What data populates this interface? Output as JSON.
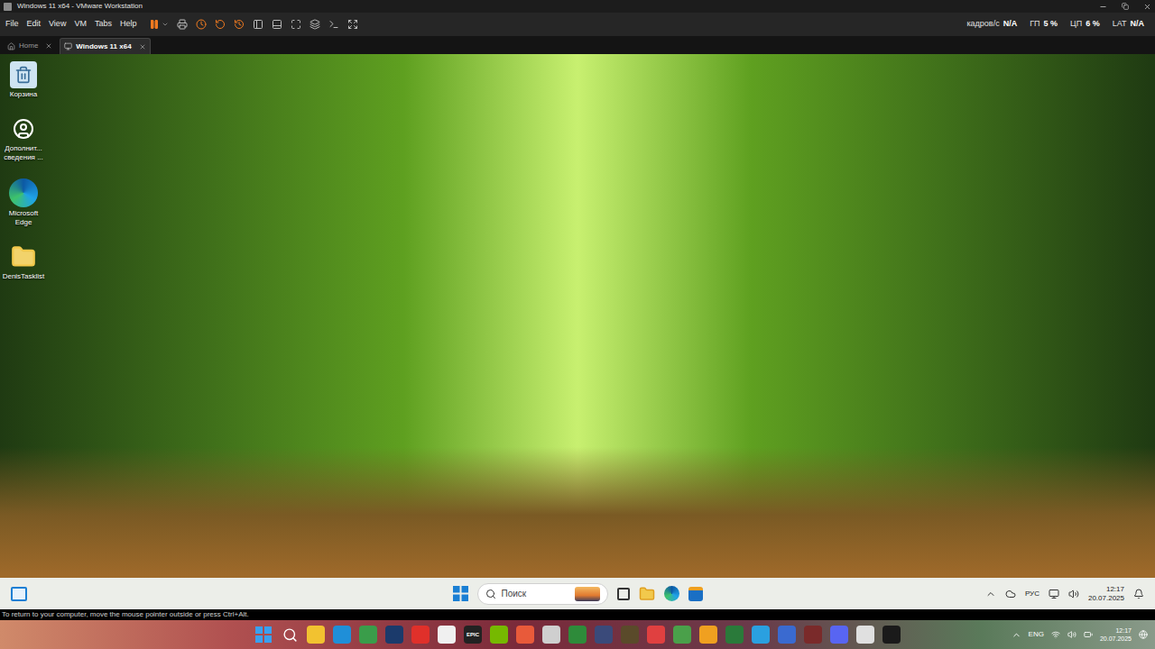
{
  "window": {
    "title": "Windows 11 x64 - VMware Workstation"
  },
  "menu": [
    "File",
    "Edit",
    "View",
    "VM",
    "Tabs",
    "Help"
  ],
  "stats": [
    {
      "label": "кадров/с",
      "value": "N/A"
    },
    {
      "label": "ГП",
      "value": "5 %"
    },
    {
      "label": "ЦП",
      "value": "6 %"
    },
    {
      "label": "LAT",
      "value": "N/A"
    }
  ],
  "tabs": [
    {
      "label": "Home",
      "kind": "home",
      "selected": false
    },
    {
      "label": "Windows 11 x64",
      "kind": "vm",
      "selected": true
    }
  ],
  "guest": {
    "desktop_icons": [
      {
        "label": "Корзина",
        "kind": "recycle"
      },
      {
        "label": "Дополнит... сведения ...",
        "kind": "info"
      },
      {
        "label": "Microsoft Edge",
        "kind": "edge"
      },
      {
        "label": "DenisTasklist",
        "kind": "folder"
      }
    ],
    "taskbar": {
      "search": {
        "placeholder": "Поиск"
      },
      "language": "РУС",
      "time": "12:17",
      "date": "20.07.2025"
    }
  },
  "status_bar": "To return to your computer, move the mouse pointer outside or press Ctrl+Alt.",
  "host_taskbar": {
    "apps": [
      {
        "kind": "windows",
        "label": "",
        "color": "#3aa0f0"
      },
      {
        "kind": "search",
        "label": "",
        "color": "#ffffff"
      },
      {
        "kind": "app",
        "label": "",
        "color": "#f2c230"
      },
      {
        "kind": "app",
        "label": "",
        "color": "#1f8fd8"
      },
      {
        "kind": "app",
        "label": "",
        "color": "#3a9d4a"
      },
      {
        "kind": "app",
        "label": "",
        "color": "#1b3a6b"
      },
      {
        "kind": "app",
        "label": "",
        "color": "#e0302a"
      },
      {
        "kind": "app",
        "label": "",
        "color": "#f0f0f0"
      },
      {
        "kind": "app",
        "label": "EPIC",
        "color": "#222222"
      },
      {
        "kind": "app",
        "label": "",
        "color": "#76b900"
      },
      {
        "kind": "app",
        "label": "",
        "color": "#e85a3a"
      },
      {
        "kind": "app",
        "label": "",
        "color": "#cfcfcf"
      },
      {
        "kind": "app",
        "label": "",
        "color": "#2e8b3a"
      },
      {
        "kind": "app",
        "label": "",
        "color": "#3a4a7a"
      },
      {
        "kind": "app",
        "label": "",
        "color": "#5a4a2a"
      },
      {
        "kind": "app",
        "label": "",
        "color": "#e04040"
      },
      {
        "kind": "app",
        "label": "",
        "color": "#4aa04a"
      },
      {
        "kind": "app",
        "label": "",
        "color": "#f0a020"
      },
      {
        "kind": "app",
        "label": "",
        "color": "#2a7a3a"
      },
      {
        "kind": "app",
        "label": "",
        "color": "#2aa0e0"
      },
      {
        "kind": "app",
        "label": "",
        "color": "#3a6ad0"
      },
      {
        "kind": "app",
        "label": "",
        "color": "#7a2a2a"
      },
      {
        "kind": "app",
        "label": "",
        "color": "#5865f2"
      },
      {
        "kind": "app",
        "label": "",
        "color": "#e0e0e0"
      },
      {
        "kind": "app",
        "label": "",
        "color": "#1a1a1a"
      }
    ],
    "language": "ENG",
    "time": "12:17",
    "date": "20.07.2025"
  }
}
